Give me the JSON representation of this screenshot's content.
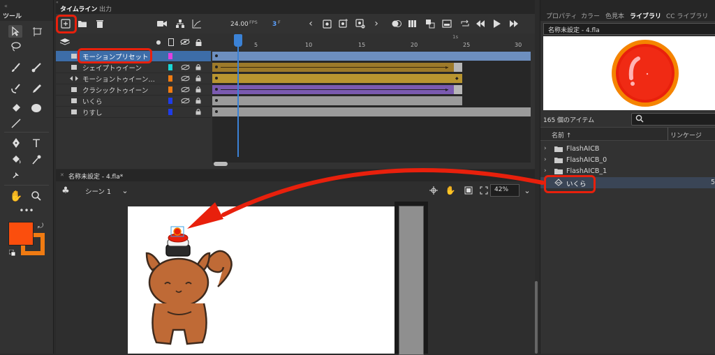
{
  "tools": {
    "title": "ツール"
  },
  "timeline": {
    "tabs": [
      "タイムライン",
      "出力"
    ],
    "fps": "24.00",
    "fps_unit": "FPS",
    "frame": "3",
    "frame_unit": "F",
    "ruler": [
      "1s",
      "5",
      "10",
      "15",
      "20",
      "25",
      "30"
    ],
    "layers": [
      {
        "name": "モーションプリセット",
        "color": "#e040e0"
      },
      {
        "name": "シェイプトゥイーン",
        "color": "#19d6d6"
      },
      {
        "name": "モーショントゥイーン…",
        "color": "#f07b12"
      },
      {
        "name": "クラシックトゥイーン",
        "color": "#f07b12"
      },
      {
        "name": "いくら",
        "color": "#1f3ce8"
      },
      {
        "name": "りすし",
        "color": "#1f3ce8"
      }
    ]
  },
  "stage": {
    "doc_tab": "名称未設定 - 4.fla*",
    "scene": "シーン 1",
    "zoom": "42%"
  },
  "library": {
    "tabs": [
      "プロパティ",
      "カラー",
      "色見本",
      "ライブラリ",
      "CC ライブラリ"
    ],
    "doc": "名称未設定 - 4.fla",
    "count": "165 個のアイテム",
    "col_name": "名前 ↑",
    "col_link": "リンケージ",
    "items": [
      {
        "name": "FlashAICB",
        "num": ""
      },
      {
        "name": "FlashAICB_0",
        "num": ""
      },
      {
        "name": "FlashAICB_1",
        "num": ""
      },
      {
        "name": "いくら",
        "num": "5"
      }
    ]
  },
  "colors": {
    "stroke": "#fb4e0d",
    "fill": "#f07b12",
    "annotation": "#e8200c"
  }
}
